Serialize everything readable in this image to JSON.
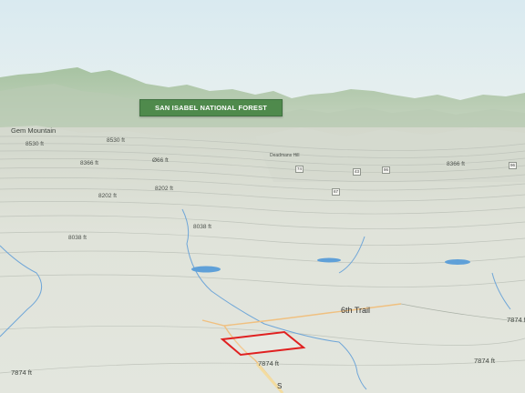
{
  "map": {
    "forest_label": "SAN ISABEL NATIONAL FOREST",
    "place_labels": {
      "gem_mountain": "Gem Mountain",
      "deadmans_hill": "Deadmans Hill"
    },
    "elevation_labels": {
      "e8530_left": "8530 ft",
      "e8530_mid": "8530 ft",
      "e8366_left": "8366 ft",
      "e8366_mid": "Ø66 ft",
      "e8366_right": "8366 ft",
      "e8202_left": "8202 ft",
      "e8202_mid": "8202 ft",
      "e8038_left": "8038 ft",
      "e8038_mid": "8038 ft",
      "e7874_left": "7874 ft",
      "e7874_road": "7874 ft",
      "e7874_right_low": "7874 ft",
      "e7874_right_edge": "7874 ft"
    },
    "trail_label": "6th Trail",
    "road_label": "S",
    "route_shields": [
      "74",
      "43",
      "96",
      "67",
      "96"
    ],
    "colors": {
      "sky": "#d6e8ee",
      "forest_banner": "#4f8a4c",
      "terrain": "#e3e6dd",
      "water": "#5fa0d8",
      "parcel_outline": "#e02020",
      "trail": "#f0c080"
    }
  }
}
